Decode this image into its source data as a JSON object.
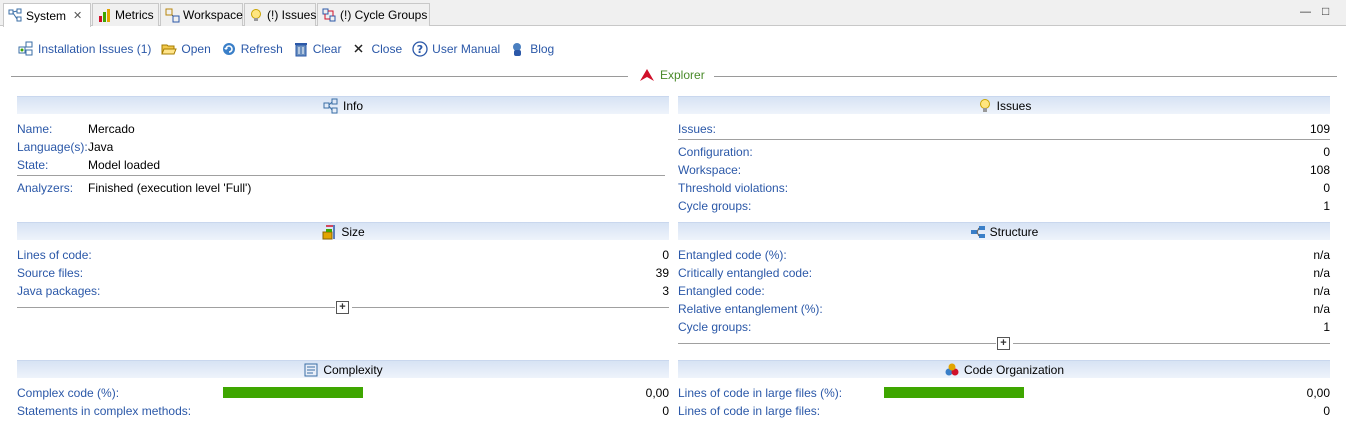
{
  "tabs": [
    {
      "label": "System",
      "close": "✕"
    },
    {
      "label": "Metrics"
    },
    {
      "label": "Workspace"
    },
    {
      "label": "(!) Issues"
    },
    {
      "label": "(!) Cycle Groups"
    }
  ],
  "window": {
    "minimize": "—",
    "maximize": "□"
  },
  "toolbar": {
    "installation_issues": "Installation Issues (1)",
    "open": "Open",
    "refresh": "Refresh",
    "clear": "Clear",
    "close": "Close",
    "user_manual": "User Manual",
    "blog": "Blog"
  },
  "explorer_label": "Explorer",
  "info": {
    "title": "Info",
    "name_label": "Name:",
    "name_value": "Mercado",
    "language_label": "Language(s):",
    "language_value": "Java",
    "state_label": "State:",
    "state_value": "Model loaded",
    "analyzers_label": "Analyzers:",
    "analyzers_value": "Finished (execution level 'Full')"
  },
  "issues": {
    "title": "Issues",
    "issues_label": "Issues:",
    "issues_value": "109",
    "rows": [
      {
        "label": "Configuration:",
        "value": "0"
      },
      {
        "label": "Workspace:",
        "value": "108"
      },
      {
        "label": "Threshold violations:",
        "value": "0"
      },
      {
        "label": "Cycle groups:",
        "value": "1"
      }
    ]
  },
  "size": {
    "title": "Size",
    "rows": [
      {
        "label": "Lines of code:",
        "value": "0"
      },
      {
        "label": "Source files:",
        "value": "39"
      },
      {
        "label": "Java packages:",
        "value": "3"
      }
    ],
    "expand": "+"
  },
  "structure": {
    "title": "Structure",
    "rows": [
      {
        "label": "Entangled code (%):",
        "value": "n/a"
      },
      {
        "label": "Critically entangled code:",
        "value": "n/a"
      },
      {
        "label": "Entangled code:",
        "value": "n/a"
      },
      {
        "label": "Relative entanglement (%):",
        "value": "n/a"
      },
      {
        "label": "Cycle groups:",
        "value": "1"
      }
    ],
    "expand": "+"
  },
  "complexity": {
    "title": "Complexity",
    "rows": [
      {
        "label": "Complex code (%):",
        "value": "0,00",
        "bar_level": 1.0
      },
      {
        "label": "Statements in complex methods:",
        "value": "0"
      }
    ]
  },
  "code_org": {
    "title": "Code Organization",
    "rows": [
      {
        "label": "Lines of code in large files (%):",
        "value": "0,00",
        "bar_level": 1.0
      },
      {
        "label": "Lines of code in large files:",
        "value": "0"
      }
    ]
  },
  "colors": {
    "link": "#2b58a8",
    "bar": "#3ea600",
    "accent_red": "#d0102a",
    "header_bg": "#d7e3f4"
  }
}
